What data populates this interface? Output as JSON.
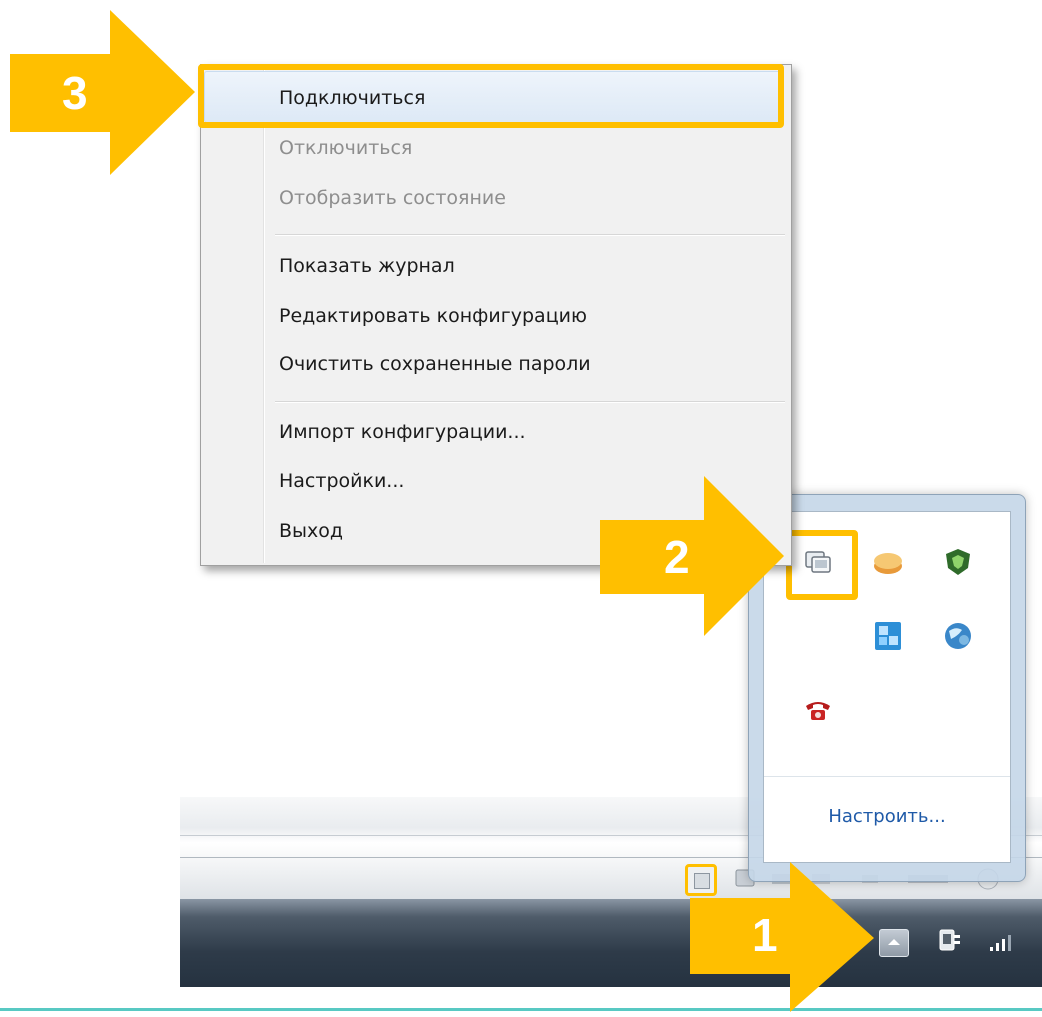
{
  "context_menu": {
    "items": [
      {
        "label": "Подключиться",
        "enabled": true
      },
      {
        "label": "Отключиться",
        "enabled": false
      },
      {
        "label": "Отобразить состояние",
        "enabled": false
      },
      {
        "label": "Показать журнал",
        "enabled": true
      },
      {
        "label": "Редактировать конфигурацию",
        "enabled": true
      },
      {
        "label": "Очистить сохраненные пароли",
        "enabled": true
      },
      {
        "label": "Импорт конфигурации...",
        "enabled": true
      },
      {
        "label": "Настройки...",
        "enabled": true
      },
      {
        "label": "Выход",
        "enabled": true
      }
    ]
  },
  "tray_flyout": {
    "customize_link": "Настроить...",
    "icons": [
      "openvpn-gui-icon",
      "disk-icon",
      "antivirus-shield-icon",
      "network-monitor-icon",
      "globe-icon",
      "phone-icon"
    ]
  },
  "callouts": {
    "step1": "1",
    "step2": "2",
    "step3": "3",
    "color": "#FFBF00"
  },
  "taskbar": {
    "icons": [
      "show-hidden-icons-icon",
      "power-plug-icon",
      "signal-bars-icon"
    ]
  }
}
